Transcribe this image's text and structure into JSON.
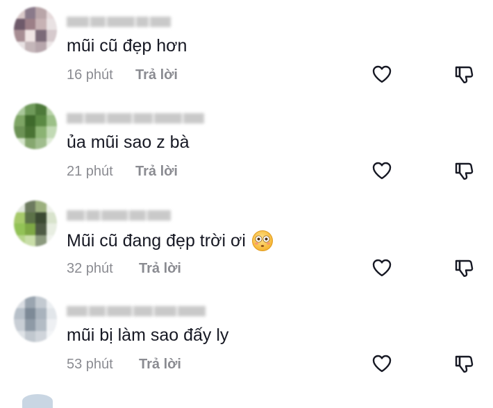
{
  "comments": [
    {
      "text": "mũi cũ đẹp hơn",
      "time": "16 phút",
      "reply_label": "Trả lời",
      "has_emoji": false,
      "avatar_colors": [
        "#d8c8c8",
        "#8a7a8a",
        "#b9a5a8",
        "#e5d9da",
        "#6e5a6a",
        "#9c7f87",
        "#c7b2b4",
        "#e9e2e3",
        "#a78d93",
        "#f0e5e4",
        "#7b6a78",
        "#d6cacd",
        "#e8e2e3",
        "#c4b6b9",
        "#b7a6ac",
        "#ede7e8"
      ]
    },
    {
      "text": "ủa mũi sao z bà",
      "time": "21 phút",
      "reply_label": "Trả lời",
      "has_emoji": false,
      "avatar_colors": [
        "#a9c79a",
        "#6f9a5a",
        "#4e7a3a",
        "#b8d3a8",
        "#7ea565",
        "#3f6a2c",
        "#5b8a44",
        "#9cc088",
        "#6c9255",
        "#4a7334",
        "#8bb373",
        "#c2dab5",
        "#d4e4c9",
        "#86a76f",
        "#a0bd8d",
        "#e0ecd8"
      ]
    },
    {
      "text": "Mũi cũ đang đẹp trời ơi",
      "time": "32 phút",
      "reply_label": "Trả lời",
      "has_emoji": true,
      "avatar_colors": [
        "#e3e9de",
        "#6d7b5f",
        "#9cb07e",
        "#eef2ea",
        "#a6c96a",
        "#5c7248",
        "#3b4a32",
        "#d8e3cc",
        "#92c256",
        "#7ea845",
        "#4e5a44",
        "#e8eee2",
        "#b5d48a",
        "#c9dea8",
        "#8c9a7e",
        "#f1f4ee"
      ]
    },
    {
      "text": "mũi bị làm sao đấy ly",
      "time": "53 phút",
      "reply_label": "Trả lời",
      "has_emoji": false,
      "avatar_colors": [
        "#d9dde2",
        "#9aa5b0",
        "#c3cad1",
        "#eceff2",
        "#b7c0c9",
        "#7d8a97",
        "#a9b3bd",
        "#e2e6ea",
        "#c8ced5",
        "#8e9aa6",
        "#b3bcc5",
        "#eef0f3",
        "#dfe3e7",
        "#c1c8cf",
        "#d0d5db",
        "#f3f5f7"
      ]
    }
  ],
  "icons": {
    "like": "heart-outline-icon",
    "dislike": "thumbs-down-outline-icon",
    "emoji": "flushed-face-emoji-icon"
  },
  "colors": {
    "text": "#161823",
    "meta": "#8a8b91",
    "icon": "#161823"
  }
}
